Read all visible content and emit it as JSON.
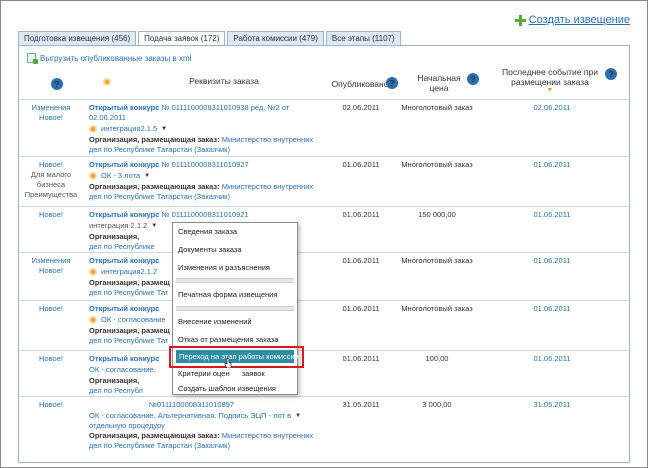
{
  "header": {
    "create_label": "Создать извещение"
  },
  "tabs": [
    {
      "label": "Подготовка извещения (456)",
      "active": false
    },
    {
      "label": "Подача заявок (172)",
      "active": true
    },
    {
      "label": "Работа комиссии (479)",
      "active": false
    },
    {
      "label": "Все этапы (1107)",
      "active": false
    }
  ],
  "export_label": "Выгрузить опубликованные заказы в xml",
  "columns": {
    "requisites": "Реквизиты заказа",
    "published": "Опубликовано",
    "price_line1": "Начальная",
    "price_line2": "цена",
    "last_line1": "Последнее событие при",
    "last_line2": "размещении заказа"
  },
  "rows": [
    {
      "status1": "Изменения",
      "status2": "Новое!",
      "status3": "",
      "status4": "",
      "kind": "Открытый конкурс",
      "num": "№  0111100008311010938 ред. №2 от",
      "num2": "02.06.2011",
      "sub": "интеграция2.1.5",
      "org_label": "Организация, размещающая заказ:",
      "org": "Министерство внутренних",
      "org2": "дел по Республике Татарстан (Заказчик)",
      "published": "02.06.2011",
      "price": "Многолотовый заказ",
      "last": "02.06.2011"
    },
    {
      "status1": "Новое!",
      "status2": "Для малого",
      "status3": "бизнеса",
      "status4": "Преимущества",
      "kind": "Открытый конкурс",
      "num": "№  0111100008311010927",
      "num2": "",
      "sub": "ОК - 3 лота",
      "org_label": "Организация, размещающая заказ:",
      "org": "Министерство внутренних",
      "org2": "дел по Республике Татарстан (Заказчик)",
      "published": "01.06.2011",
      "price": "Многолотовый заказ",
      "last": "01.06.2011"
    },
    {
      "status1": "Новое!",
      "status2": "",
      "status3": "",
      "status4": "",
      "kind": "Открытый конкурс",
      "num": "№  0111100008311010921",
      "num2": "",
      "sub": "интеграция 2.1.2",
      "org_label": "Организация,",
      "org": "",
      "org2": "дел по Республике",
      "published": "01.06.2011",
      "price": "150 000,00",
      "last": "01.06.2011"
    },
    {
      "status1": "Изменения",
      "status2": "Новое!",
      "status3": "",
      "status4": "",
      "kind": "Открытый конкурс",
      "num": "",
      "num2": "",
      "sub": "интеграция2.1.2",
      "org_label": "Организация, размещ",
      "org": "",
      "org2": "дел по Республике Тат",
      "published": "01.06.2011",
      "price": "Многолотовый заказ",
      "last": "01.06.2011"
    },
    {
      "status1": "Новое!",
      "status2": "",
      "status3": "",
      "status4": "",
      "kind": "Открытый конкурс",
      "num": "",
      "num2": "",
      "sub": "ОК - согласование",
      "org_label": "Организация, размещ",
      "org": "",
      "org2": "дел по Республике Тат",
      "published": "01.06.2011",
      "price": "Многолотовый заказ",
      "last": "01.06.2011"
    },
    {
      "status1": "Новое!",
      "status2": "",
      "status3": "",
      "status4": "",
      "kind": "Открытый конкурс",
      "num": "",
      "num2": "",
      "sub": "ОК - согласование.",
      "org_label": "Организация,",
      "org": "",
      "org2": "дел по Республ",
      "published": "01.06.2011",
      "price": "100,00",
      "last": "01.06.2011"
    },
    {
      "status1": "Новое!",
      "status2": "",
      "status3": "",
      "status4": "",
      "kind": "",
      "num": "№0111100008311010897",
      "num2": "",
      "sub": "ОК - согласование. Альтернативная. Подпись ЭЦП - лот в",
      "sub2": "отдельную процедуру",
      "org_label": "Организация, размещающая заказ:",
      "org": "Министерство внутренних",
      "org2": "дел по Республике Татарстан (Заказчик)",
      "published": "31.05.2011",
      "price": "3 000,00",
      "last": "31.05.2011"
    }
  ],
  "menu": [
    "Сведения заказа",
    "Документы заказа",
    "Изменения и разъяснения",
    "Печатная форма извещения",
    "Внесение изменений",
    "Отказ от размещения заказа",
    "Переход на этап работы комиссии",
    "Критерии оцен",
    "заявок",
    "Создать шаблон извещения"
  ]
}
